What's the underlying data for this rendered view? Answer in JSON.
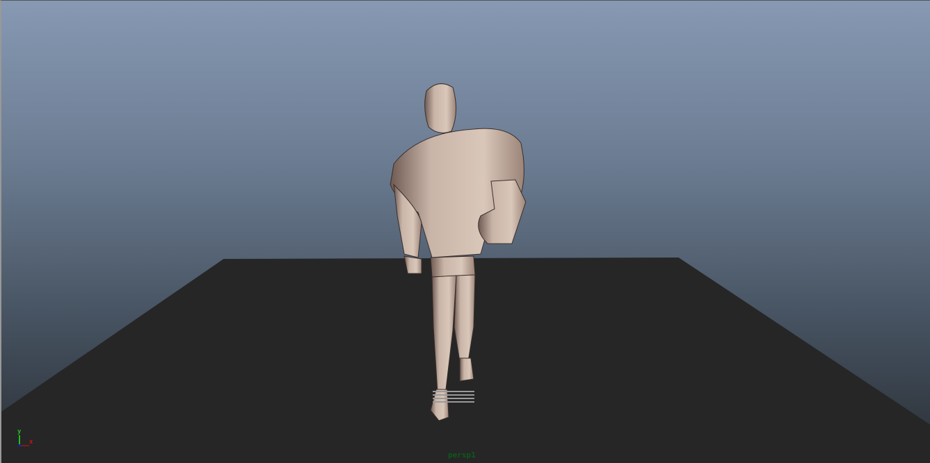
{
  "viewport": {
    "camera_label": "persp1",
    "axis_labels": {
      "y": "y",
      "x": "x"
    },
    "colors": {
      "ground": "#262626",
      "skin": "#c4b1a4",
      "axis_x": "#d01010",
      "axis_y": "#20c020",
      "axis_z": "#1020d0",
      "camera_label": "#0b5a1c"
    }
  }
}
